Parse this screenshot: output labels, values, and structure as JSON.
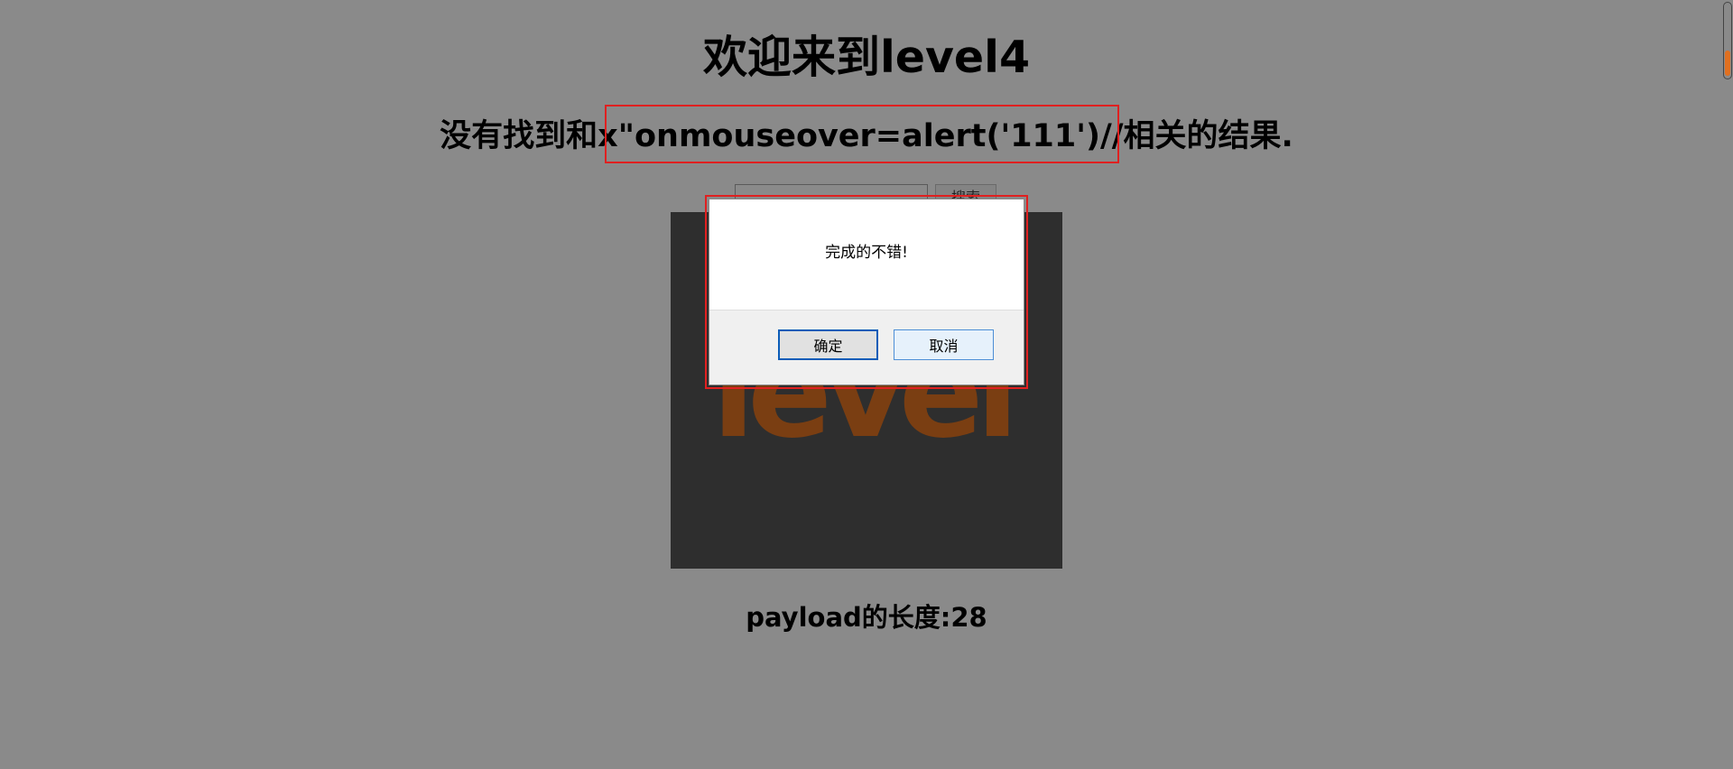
{
  "page": {
    "title": "欢迎来到level4",
    "result_message": "没有找到和x\"onmouseover=alert('111')//相关的结果.",
    "payload_length": "payload的长度:28"
  },
  "search": {
    "input_value": "",
    "button_label": "搜索"
  },
  "image": {
    "text": "level"
  },
  "alert": {
    "message": "完成的不错!",
    "ok_label": "确定",
    "cancel_label": "取消"
  },
  "colors": {
    "page_background": "#8a8a8a",
    "highlight_border": "#e02020",
    "image_background": "#2e2e2e",
    "image_text": "#7a3e12",
    "scrollbar_thumb": "#e07020"
  }
}
